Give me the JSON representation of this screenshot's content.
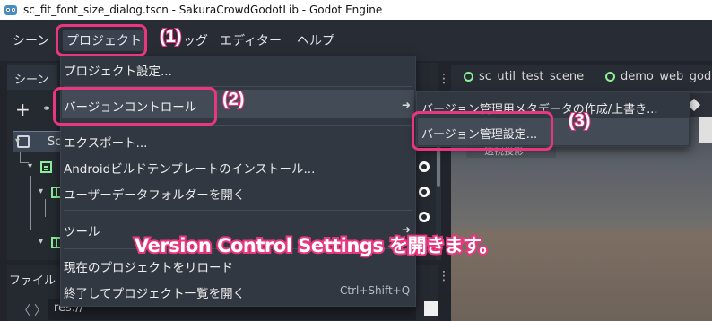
{
  "window": {
    "title": "sc_fit_font_size_dialog.tscn - SakuraCrowdGodotLib - Godot Engine"
  },
  "menubar": {
    "items": [
      "シーン",
      "プロジェクト",
      "デバッグ",
      "エディター",
      "ヘルプ"
    ],
    "visible_fragments": {
      "debug": "ッグ"
    }
  },
  "scene_dock": {
    "tab_label": "シーン",
    "add_button": "+",
    "root_label": "Sc"
  },
  "filesystem_dock": {
    "tab_label": "ファイル",
    "path_value": "res://",
    "back": "〈",
    "forward": "〉"
  },
  "editor": {
    "tabs": [
      "sc_util_test_scene",
      "demo_web_god"
    ],
    "viewport_chip": "透視投影"
  },
  "project_menu": {
    "items": [
      {
        "label": "プロジェクト設定...",
        "shortcut": ""
      },
      {
        "label": "バージョンコントロール",
        "shortcut": "",
        "submenu": true
      },
      {
        "label": "エクスポート...",
        "shortcut": ""
      },
      {
        "label": "Androidビルドテンプレートのインストール...",
        "shortcut": ""
      },
      {
        "label": "ユーザーデータフォルダーを開く",
        "shortcut": ""
      },
      {
        "label": "ツール",
        "shortcut": "",
        "submenu": true
      },
      {
        "label": "現在のプロジェクトをリロード",
        "shortcut": ""
      },
      {
        "label": "終了してプロジェクト一覧を開く",
        "shortcut": "Ctrl+Shift+Q"
      }
    ]
  },
  "vcs_submenu": {
    "items": [
      "バージョン管理用メタデータの作成/上書き...",
      "バージョン管理設定..."
    ]
  },
  "annotations": {
    "step1": "(1)",
    "step2": "(2)",
    "step3": "(3)",
    "caption": "Version Control Settings を開きます。",
    "color": "#e8377f"
  },
  "icons": [
    "godot-logo-icon",
    "add-icon",
    "link-icon",
    "checkbox-icon",
    "tree-arrow-icon",
    "container-node-icon",
    "eye-icon",
    "scene-tab-icon",
    "submenu-arrow-icon"
  ]
}
